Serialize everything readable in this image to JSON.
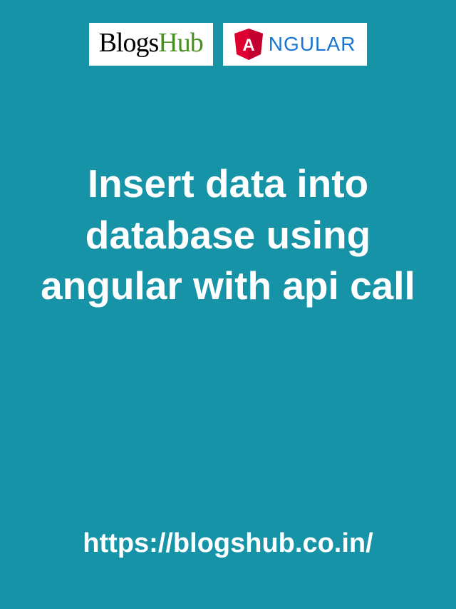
{
  "header": {
    "blogshub_logo": {
      "blogs": "Blogs",
      "hub": "Hub"
    },
    "angular_logo": {
      "letter": "A",
      "text": "NGULAR"
    }
  },
  "main": {
    "title": "Insert data into database using angular with api call"
  },
  "footer": {
    "url": "https://blogshub.co.in/"
  }
}
